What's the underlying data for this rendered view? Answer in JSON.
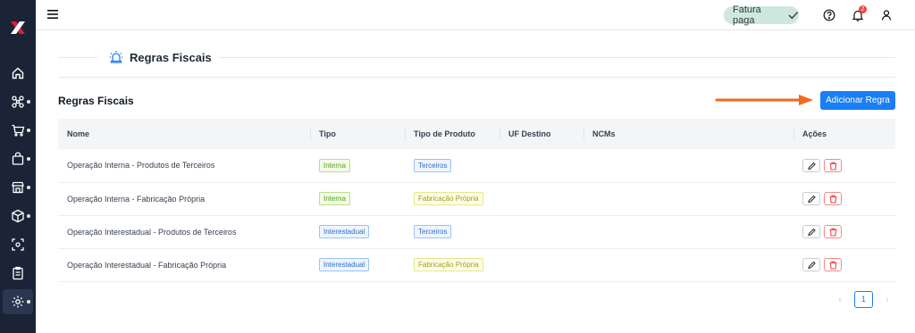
{
  "topbar": {
    "fatura_label": "Fatura paga",
    "notification_count": "2"
  },
  "page": {
    "title": "Regras Fiscais"
  },
  "section": {
    "title": "Regras Fiscais",
    "add_button": "Adicionar Regra"
  },
  "table": {
    "headers": [
      "Nome",
      "Tipo",
      "Tipo de Produto",
      "UF Destino",
      "NCMs",
      "Ações"
    ],
    "rows": [
      {
        "nome": "Operação Interna - Produtos de Terceiros",
        "tipo": "Interna",
        "tipo_produto": "Terceiros",
        "uf": "",
        "ncms": ""
      },
      {
        "nome": "Operação Interna - Fabricação Própria",
        "tipo": "Interna",
        "tipo_produto": "Fabricação Própria",
        "uf": "",
        "ncms": ""
      },
      {
        "nome": "Operação Interestadual - Produtos de Terceiros",
        "tipo": "Interestadual",
        "tipo_produto": "Terceiros",
        "uf": "",
        "ncms": ""
      },
      {
        "nome": "Operação Interestadual - Fabricação Própria",
        "tipo": "Interestadual",
        "tipo_produto": "Fabricação Própria",
        "uf": "",
        "ncms": ""
      }
    ]
  },
  "pagination": {
    "current_page": "1"
  },
  "colors": {
    "sidebar": "#1b2337",
    "primary": "#1a7ef5",
    "arrow": "#f26a1b",
    "fatura_bg": "#cfe8de",
    "danger": "#ef4444"
  },
  "icons": {
    "sidebar": [
      "home-icon",
      "network-icon",
      "cart-icon",
      "bag-icon",
      "store-icon",
      "box-icon",
      "scan-icon",
      "clipboard-icon",
      "gear-icon"
    ],
    "topbar": [
      "menu-icon",
      "check-icon",
      "help-icon",
      "bell-icon",
      "user-icon"
    ]
  }
}
